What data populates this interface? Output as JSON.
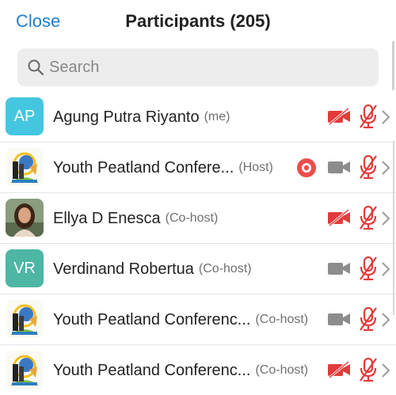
{
  "header": {
    "close_label": "Close",
    "title": "Participants (205)"
  },
  "search": {
    "placeholder": "Search",
    "value": ""
  },
  "colors": {
    "accent": "#1f7fd0",
    "muted_red": "#e23b3b",
    "avatar_teal": "#4fc3d6",
    "avatar_green": "#45b3a4"
  },
  "participants": [
    {
      "name": "Agung Putra Riyanto",
      "role": "(me)",
      "avatar": "AP",
      "avatar_type": "initials",
      "avatar_color": "#45c6e0",
      "video": "off",
      "mic": "muted",
      "recording": false
    },
    {
      "name": "Youth Peatland Confere...",
      "role": "(Host)",
      "avatar": "",
      "avatar_type": "logo",
      "video": "on",
      "mic": "muted",
      "recording": true
    },
    {
      "name": "Ellya D Enesca",
      "role": "(Co-host)",
      "avatar": "",
      "avatar_type": "photo",
      "video": "off",
      "mic": "muted",
      "recording": false
    },
    {
      "name": "Verdinand Robertua",
      "role": "(Co-host)",
      "avatar": "VR",
      "avatar_type": "initials",
      "avatar_color": "#4db6a5",
      "video": "on",
      "mic": "muted",
      "recording": false
    },
    {
      "name": "Youth Peatland Conferenc...",
      "role": "(Co-host)",
      "avatar": "",
      "avatar_type": "logo",
      "video": "on",
      "mic": "muted",
      "recording": false
    },
    {
      "name": "Youth Peatland Conferenc...",
      "role": "(Co-host)",
      "avatar": "",
      "avatar_type": "logo",
      "video": "off",
      "mic": "muted",
      "recording": false
    }
  ]
}
